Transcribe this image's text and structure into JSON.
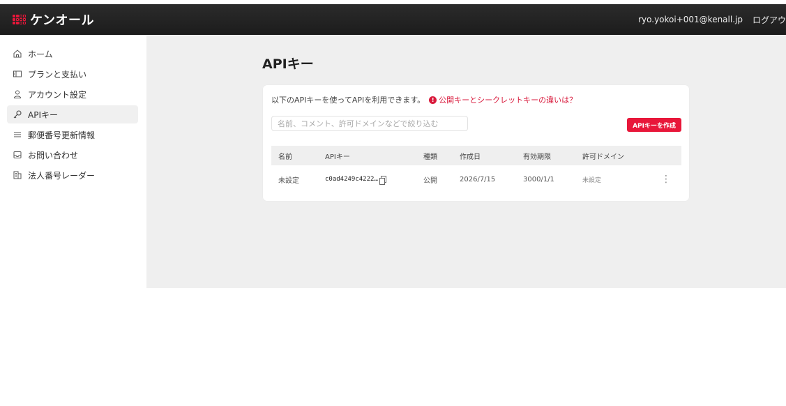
{
  "header": {
    "brand": "ケンオール",
    "user_email": "ryo.yokoi+001@kenall.jp",
    "logout_label": "ログアウ"
  },
  "sidebar": {
    "items": [
      {
        "label": "ホーム",
        "icon": "home-icon"
      },
      {
        "label": "プランと支払い",
        "icon": "ticket-icon"
      },
      {
        "label": "アカウント設定",
        "icon": "user-icon"
      },
      {
        "label": "APIキー",
        "icon": "key-icon",
        "active": true
      },
      {
        "label": "郵便番号更新情報",
        "icon": "list-icon"
      },
      {
        "label": "お問い合わせ",
        "icon": "inbox-icon"
      },
      {
        "label": "法人番号レーダー",
        "icon": "building-icon"
      }
    ]
  },
  "main": {
    "title": "APIキー",
    "description": "以下のAPIキーを使ってAPIを利用できます。",
    "help_link": "公開キーとシークレットキーの違いは？",
    "search_placeholder": "名前、コメント、許可ドメインなどで絞り込む",
    "create_button": "APIキーを作成",
    "table": {
      "columns": [
        "名前",
        "APIキー",
        "種類",
        "作成日",
        "有効期限",
        "許可ドメイン"
      ],
      "rows": [
        {
          "name": "未設定",
          "api_key": "c0ad4249c4222…",
          "type": "公開",
          "created": "2026/7/15",
          "expires": "3000/1/1",
          "domain": "未設定"
        }
      ]
    }
  },
  "colors": {
    "accent": "#e8173a",
    "header_bg": "#222222",
    "content_bg": "#efefef"
  }
}
